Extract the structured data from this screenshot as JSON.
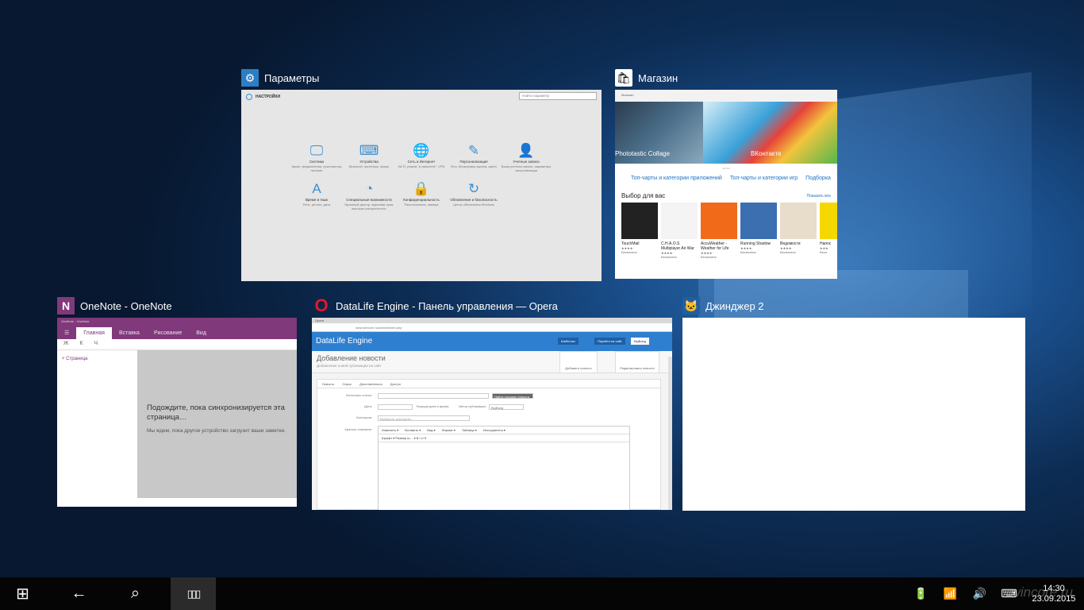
{
  "windows": {
    "settings": {
      "title": "Параметры",
      "header": "НАСТРОЙКИ",
      "search_placeholder": "Найти параметр",
      "items": [
        {
          "icon": "🖵",
          "label": "Система",
          "sub": "Экран, уведомления, приложения, питание"
        },
        {
          "icon": "⌨",
          "label": "Устройства",
          "sub": "Bluetooth, принтеры, мышь"
        },
        {
          "icon": "🌐",
          "label": "Сеть и Интернет",
          "sub": "Wi-Fi, режим \"в самолете\", VPN"
        },
        {
          "icon": "✎",
          "label": "Персонализация",
          "sub": "Фон, блокировка экрана, цвета"
        },
        {
          "icon": "👤",
          "label": "Учетные записи",
          "sub": "Ваша учетная запись, параметры синхронизации"
        },
        {
          "icon": "A",
          "label": "Время и язык",
          "sub": "Речь, регион, дата"
        },
        {
          "icon": "◔",
          "label": "Специальные возможности",
          "sub": "Экранный диктор, экранная лупа, высокая контрастность"
        },
        {
          "icon": "🔒",
          "label": "Конфиденциальность",
          "sub": "Расположение, камера"
        },
        {
          "icon": "↻",
          "label": "Обновление и безопасность",
          "sub": "Центр обновления Windows"
        }
      ]
    },
    "store": {
      "title": "Магазин",
      "topbar": "Магазин",
      "hero1": "Phototastic Collage",
      "hero2": "ВКонтакте",
      "dots": "• • • •",
      "links": [
        "Топ-чарты и категории приложений",
        "Топ-чарты и категории игр",
        "Подборка"
      ],
      "section": "Выбор для вас",
      "show_all": "Показать все",
      "apps": [
        {
          "name": "TouchMail",
          "rating": "★★★★·",
          "price": "Бесплатно",
          "color": "#222"
        },
        {
          "name": "C.H.A.O.S Multiplayer Air War",
          "rating": "★★★★·",
          "price": "Бесплатно",
          "color": "#f4f4f4"
        },
        {
          "name": "AccuWeather - Weather for Life",
          "rating": "★★★★·",
          "price": "Бесплатно",
          "color": "#f06a1a"
        },
        {
          "name": "Running Shadow",
          "rating": "★★★★·",
          "price": "Бесплатно",
          "color": "#3b6fb0"
        },
        {
          "name": "Ведомости",
          "rating": "★★★★·",
          "price": "Бесплатно",
          "color": "#e8dccb"
        },
        {
          "name": "Напос",
          "rating": "★★★",
          "price": "Бесп",
          "color": "#f5d800"
        }
      ]
    },
    "onenote": {
      "title": "OneNote - OneNote",
      "titlebar": "OneNote - OneNote",
      "tabs": [
        "Главная",
        "Вставка",
        "Рисование",
        "Вид"
      ],
      "format": "Ж К Ч",
      "page_link": "+  Страница",
      "msg1": "Подождите, пока синхронизируется эта страница…",
      "msg2": "Мы ждем, пока другое устройство загрузит ваши заметки."
    },
    "opera": {
      "title": "DataLife Engine - Панель управления — Opera",
      "tabbar": "Opera",
      "address": "www.wincore.ru/admin/index.php",
      "brand": "DataLife Engine",
      "btn1": "Шаблоны",
      "btn2": "Перейти на сайт",
      "user": "BigBang",
      "page_title": "Добавление новости",
      "page_sub": "Добавление новой публикации на сайт",
      "act1": "Добавить новость",
      "act2": "Редактировать новости",
      "form_tabs": [
        "Новость",
        "Опрос",
        "Дополнительно",
        "Доступ"
      ],
      "f_title": "Заголовок статьи:",
      "f_title_btn": "Найти похожие новости",
      "f_date": "Дата:",
      "f_date_cb": "Текущая дата и время",
      "f_author": "Автор публикации:",
      "f_author_val": "BigBang",
      "f_cat": "Категория:",
      "f_cat_val": "Выберите категорию…",
      "f_short": "Краткое описание:",
      "editor_menu": [
        "Изменить ▾",
        "Вставить ▾",
        "Вид ▾",
        "Формат ▾",
        "Таблица ▾",
        "Инструменты ▾"
      ],
      "editor_font": "Шрифт ▾   Размер ш… ▾   B I U S"
    },
    "ginger": {
      "title": "Джинджер 2"
    }
  },
  "taskbar": {
    "start": "⊞",
    "back": "←",
    "search": "⌕",
    "taskview": "▯▯▯",
    "battery": "🔋",
    "wifi": "📶",
    "volume": "🔊",
    "keyboard": "⌨",
    "time": "14:30",
    "date": "23.09.2015"
  },
  "watermark": "wincore.ru"
}
